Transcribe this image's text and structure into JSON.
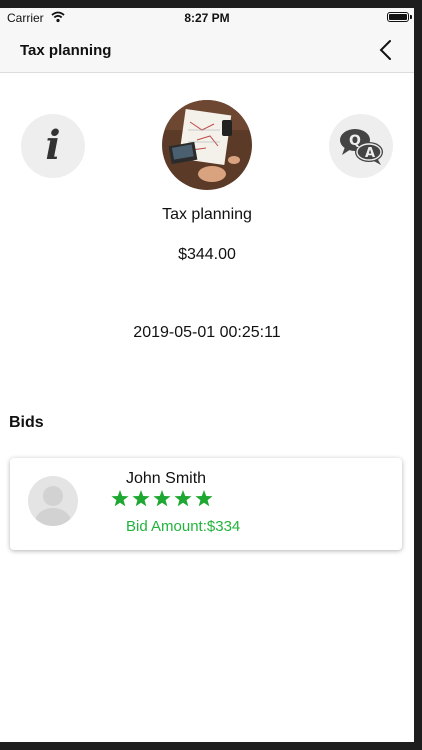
{
  "status_bar": {
    "carrier": "Carrier",
    "time": "8:27 PM"
  },
  "nav": {
    "title": "Tax planning",
    "back_icon": "chevron-left-icon"
  },
  "actions": {
    "info_icon": "info-icon",
    "info_glyph": "i",
    "qa_icon": "q-and-a-icon"
  },
  "product": {
    "title": "Tax planning",
    "price": "$344.00",
    "datetime": "2019-05-01 00:25:11"
  },
  "bids": {
    "heading": "Bids",
    "items": [
      {
        "name": "John Smith",
        "rating": 5,
        "rating_max": 5,
        "amount_text": "Bid Amount:$334"
      }
    ]
  },
  "colors": {
    "accent_green": "#22b33c",
    "star_green": "#1ea832"
  }
}
